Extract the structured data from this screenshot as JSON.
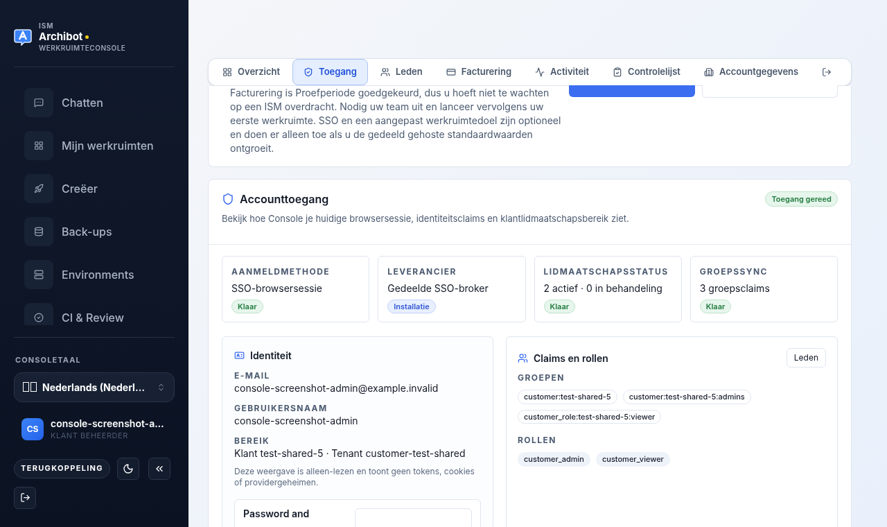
{
  "brand": {
    "eyebrow": "ISM",
    "name": "Archibot",
    "subtitle": "WERKRUIMTECONSOLE"
  },
  "nav": [
    {
      "label": "Chatten",
      "kind": "chat"
    },
    {
      "label": "Mijn werkruimten",
      "kind": "grid"
    },
    {
      "label": "Creëer",
      "kind": "rocket"
    },
    {
      "label": "Back-ups",
      "kind": "database"
    },
    {
      "label": "Environments",
      "kind": "server"
    },
    {
      "label": "CI & Review",
      "kind": "check"
    }
  ],
  "language": {
    "label": "CONSOLETAAL",
    "value": "Nederlands (Nederl…"
  },
  "user": {
    "initials": "CS",
    "name": "console-screenshot-a…",
    "role": "KLANT BEHEERDER"
  },
  "feedback_button": "TERUGKOPPELING",
  "tabs": [
    {
      "label": "Overzicht",
      "kind": "grid",
      "selected": false
    },
    {
      "label": "Toegang",
      "kind": "shield",
      "selected": true
    },
    {
      "label": "Leden",
      "kind": "users",
      "selected": false
    },
    {
      "label": "Facturering",
      "kind": "card",
      "selected": false
    },
    {
      "label": "Activiteit",
      "kind": "activity",
      "selected": false
    },
    {
      "label": "Controlelijst",
      "kind": "list",
      "selected": false
    },
    {
      "label": "Accountgegevens",
      "kind": "building",
      "selected": false
    },
    {
      "kind": "logout",
      "selected": false
    }
  ],
  "intro": {
    "text": "Facturering is Proefperiode goedgekeurd, dus u hoeft niet te wachten op een ISM overdracht. Nodig uw team uit en lanceer vervolgens uw eerste werkruimte. SSO en een aangepast werkruimtedoel zijn optioneel en doen er alleen toe als u de gedeeld gehoste standaardwaarden ontgroeit."
  },
  "access": {
    "title": "Accounttoegang",
    "badge": "Toegang gereed",
    "description": "Bekijk hoe Console je huidige browsersessie, identiteitsclaims en klantlidmaatschapsbereik ziet.",
    "stats": [
      {
        "label": "AANMELDMETHODE",
        "value": "SSO-browsersessie",
        "status": "Klaar",
        "kind": "ready"
      },
      {
        "label": "LEVERANCIER",
        "value": "Gedeelde SSO-broker",
        "status": "Installatie",
        "kind": "setup"
      },
      {
        "label": "LIDMAATSCHAPSSTATUS",
        "value": "2 actief · 0 in behandeling",
        "status": "Klaar",
        "kind": "ready"
      },
      {
        "label": "GROEPSSYNC",
        "value": "3 groepsclaims",
        "status": "Klaar",
        "kind": "ready"
      }
    ]
  },
  "identity": {
    "title": "Identiteit",
    "fields": [
      {
        "label": "E-MAIL",
        "value": "console-screenshot-admin@example.invalid"
      },
      {
        "label": "GEBRUIKERSNAAM",
        "value": "console-screenshot-admin"
      },
      {
        "label": "BEREIK",
        "value": "Klant test-shared-5 · Tenant customer-test-shared"
      }
    ],
    "note": "Deze weergave is alleen-lezen en toont geen tokens, cookies of providergeheimen.",
    "password_title": "Password and"
  },
  "claims": {
    "title": "Claims en rollen",
    "button": "Leden",
    "groups_label": "GROEPEN",
    "groups": [
      "customer:test-shared-5",
      "customer:test-shared-5:admins",
      "customer_role:test-shared-5:viewer"
    ],
    "roles_label": "ROLLEN",
    "roles": [
      "customer_admin",
      "customer_viewer"
    ]
  }
}
